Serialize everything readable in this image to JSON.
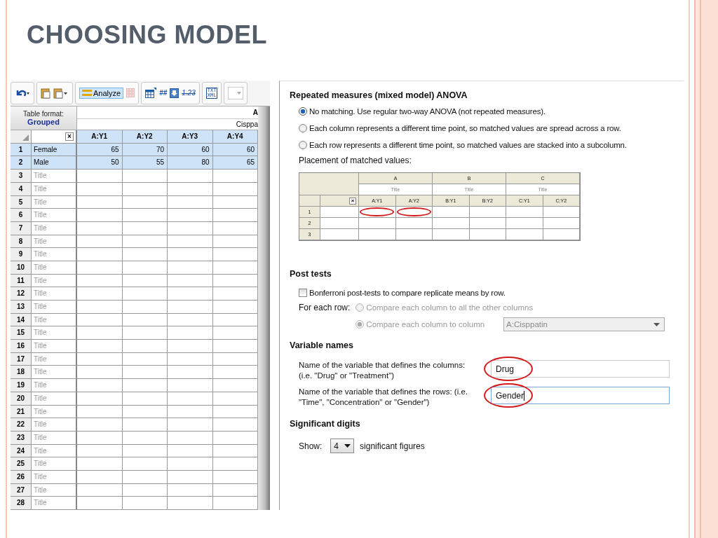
{
  "slide": {
    "title": "CHOOSING MODEL"
  },
  "toolbar": {
    "analyze": "Analyze",
    "hash_glyph": "##",
    "number_format": "1.23",
    "export_lines": [
      "TXT",
      "XML"
    ]
  },
  "sheet": {
    "clear_glyph": "×",
    "table_format_label": "Table format:",
    "table_format": "Grouped",
    "group_letter": "A",
    "group_title": "Cisppa",
    "columns": [
      {
        "label": "A:Y1",
        "selected": true
      },
      {
        "label": "A:Y2",
        "selected": true
      },
      {
        "label": "A:Y3",
        "selected": true
      },
      {
        "label": "A:Y4",
        "selected": true
      }
    ],
    "rows": [
      {
        "number": "1",
        "title": "Female",
        "placeholder_title": false,
        "selected": true,
        "values": [
          "65",
          "70",
          "60",
          "60"
        ]
      },
      {
        "number": "2",
        "title": "Male",
        "placeholder_title": false,
        "selected": true,
        "values": [
          "50",
          "55",
          "80",
          "65"
        ]
      },
      {
        "number": "3",
        "title": "Title",
        "placeholder_title": true,
        "selected": false,
        "values": []
      },
      {
        "number": "4",
        "title": "Title",
        "placeholder_title": true,
        "selected": false,
        "values": []
      },
      {
        "number": "5",
        "title": "Title",
        "placeholder_title": true,
        "selected": false,
        "values": []
      },
      {
        "number": "6",
        "title": "Title",
        "placeholder_title": true,
        "selected": false,
        "values": []
      },
      {
        "number": "7",
        "title": "Title",
        "placeholder_title": true,
        "selected": false,
        "values": []
      },
      {
        "number": "8",
        "title": "Title",
        "placeholder_title": true,
        "selected": false,
        "values": []
      },
      {
        "number": "9",
        "title": "Title",
        "placeholder_title": true,
        "selected": false,
        "values": []
      },
      {
        "number": "10",
        "title": "Title",
        "placeholder_title": true,
        "selected": false,
        "values": []
      },
      {
        "number": "11",
        "title": "Title",
        "placeholder_title": true,
        "selected": false,
        "values": []
      },
      {
        "number": "12",
        "title": "Title",
        "placeholder_title": true,
        "selected": false,
        "values": []
      },
      {
        "number": "13",
        "title": "Title",
        "placeholder_title": true,
        "selected": false,
        "values": []
      },
      {
        "number": "14",
        "title": "Title",
        "placeholder_title": true,
        "selected": false,
        "values": []
      },
      {
        "number": "15",
        "title": "Title",
        "placeholder_title": true,
        "selected": false,
        "values": []
      },
      {
        "number": "16",
        "title": "Title",
        "placeholder_title": true,
        "selected": false,
        "values": []
      },
      {
        "number": "17",
        "title": "Title",
        "placeholder_title": true,
        "selected": false,
        "values": []
      },
      {
        "number": "18",
        "title": "Title",
        "placeholder_title": true,
        "selected": false,
        "values": []
      },
      {
        "number": "19",
        "title": "Title",
        "placeholder_title": true,
        "selected": false,
        "values": []
      },
      {
        "number": "20",
        "title": "Title",
        "placeholder_title": true,
        "selected": false,
        "values": []
      },
      {
        "number": "21",
        "title": "Title",
        "placeholder_title": true,
        "selected": false,
        "values": []
      },
      {
        "number": "22",
        "title": "Title",
        "placeholder_title": true,
        "selected": false,
        "values": []
      },
      {
        "number": "23",
        "title": "Title",
        "placeholder_title": true,
        "selected": false,
        "values": []
      },
      {
        "number": "24",
        "title": "Title",
        "placeholder_title": true,
        "selected": false,
        "values": []
      },
      {
        "number": "25",
        "title": "Title",
        "placeholder_title": true,
        "selected": false,
        "values": []
      },
      {
        "number": "26",
        "title": "Title",
        "placeholder_title": true,
        "selected": false,
        "values": []
      },
      {
        "number": "27",
        "title": "Title",
        "placeholder_title": true,
        "selected": false,
        "values": []
      },
      {
        "number": "28",
        "title": "Title",
        "placeholder_title": true,
        "selected": false,
        "values": []
      }
    ]
  },
  "repeated_measures": {
    "heading": "Repeated measures (mixed model) ANOVA",
    "options": [
      {
        "label": "No matching. Use regular two-way ANOVA (not repeated measures).",
        "selected": true
      },
      {
        "label": "Each column represents a different time point, so matched values are spread across a row.",
        "selected": false
      },
      {
        "label": "Each row represents a different time point, so matched values are stacked into a subcolumn.",
        "selected": false
      }
    ],
    "placement_label": "Placement of matched values:",
    "preview": {
      "clear_glyph": "×",
      "groups": [
        {
          "letter": "A",
          "title": "Title"
        },
        {
          "letter": "B",
          "title": "Title"
        },
        {
          "letter": "C",
          "title": "Title"
        }
      ],
      "subcolumns": [
        {
          "label": "A:Y1",
          "circled": true
        },
        {
          "label": "A:Y2",
          "circled": true
        },
        {
          "label": "B:Y1",
          "circled": false
        },
        {
          "label": "B:Y2",
          "circled": false
        },
        {
          "label": "C:Y1",
          "circled": false
        },
        {
          "label": "C:Y2",
          "circled": false
        }
      ],
      "rows": [
        "1",
        "2",
        "3"
      ]
    }
  },
  "post_tests": {
    "heading": "Post tests",
    "bonferroni": {
      "label": "Bonferroni post-tests to compare replicate means by row.",
      "checked": false
    },
    "for_each_row_label": "For each row:",
    "options": [
      {
        "label": "Compare each column to all the other columns",
        "selected": false,
        "disabled": true
      },
      {
        "label": "Compare each column to column",
        "selected": true,
        "disabled": true
      }
    ],
    "compare_to": {
      "value": "A:Cisppatin",
      "disabled": true
    }
  },
  "variable_names": {
    "heading": "Variable names",
    "fields": [
      {
        "label": "Name of the variable that defines the columns: (i.e. \"Drug\" or \"Treatment\")",
        "value": "Drug",
        "focused": false,
        "circled": true
      },
      {
        "label": "Name of the variable that defines the rows: (i.e. \"Time\", \"Concentration\" or \"Gender\")",
        "value": "Gender",
        "focused": true,
        "circled": true
      }
    ]
  },
  "significant_digits": {
    "heading": "Significant digits",
    "show_label": "Show:",
    "digits": "4",
    "suffix": "significant figures"
  }
}
